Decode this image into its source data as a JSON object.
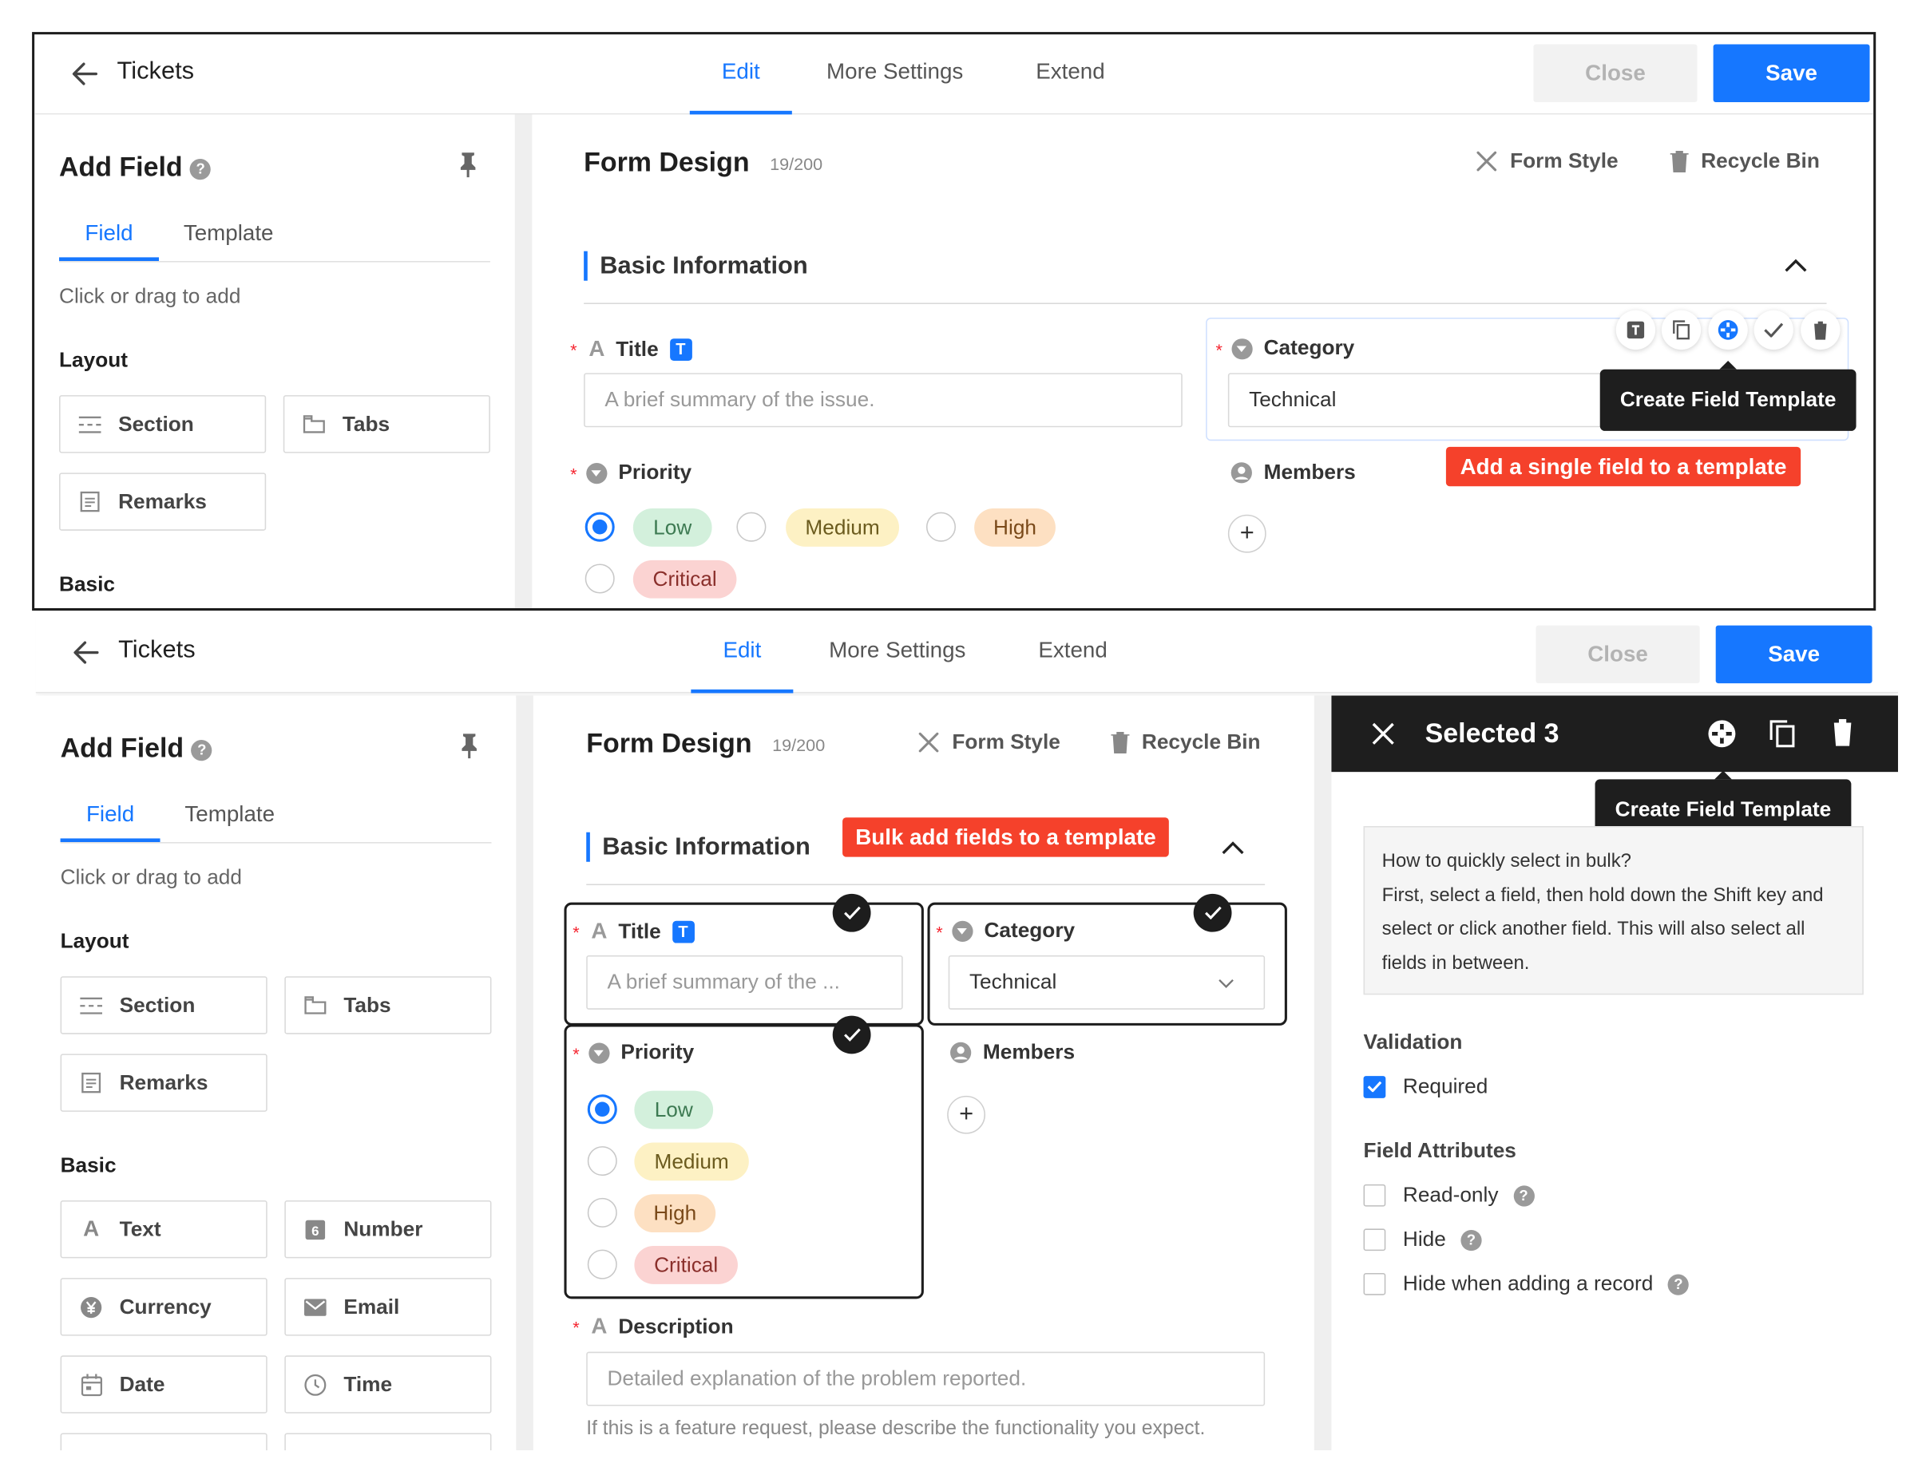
{
  "header": {
    "back_label": "Tickets",
    "tabs": [
      "Edit",
      "More Settings",
      "Extend"
    ],
    "close": "Close",
    "save": "Save"
  },
  "sidebar": {
    "title": "Add Field",
    "tabs": [
      "Field",
      "Template"
    ],
    "hint": "Click or drag to add",
    "layout_label": "Layout",
    "layout_items": [
      "Section",
      "Tabs",
      "Remarks"
    ],
    "basic_label": "Basic",
    "basic_items": [
      "Text",
      "Number",
      "Currency",
      "Email",
      "Date",
      "Time"
    ]
  },
  "form": {
    "title": "Form Design",
    "count": "19/200",
    "form_style": "Form Style",
    "recycle_bin": "Recycle Bin",
    "section": "Basic Information",
    "title_field": {
      "label": "Title",
      "badge": "T",
      "placeholder": "A brief summary of the issue.",
      "placeholder_truncated": "A brief summary of the ..."
    },
    "category_field": {
      "label": "Category",
      "value": "Technical"
    },
    "priority_field": {
      "label": "Priority",
      "options": [
        "Low",
        "Medium",
        "High",
        "Critical"
      ],
      "selected": "Low"
    },
    "members_field": {
      "label": "Members",
      "add": "+"
    },
    "description_field": {
      "label": "Description",
      "placeholder": "Detailed explanation of the problem reported.",
      "help": "If this is a feature request, please describe the functionality you expect."
    }
  },
  "annotations": {
    "single": "Add a single field to a template",
    "bulk": "Bulk add fields to a template",
    "tooltip": "Create Field Template"
  },
  "right_panel": {
    "title": "Selected 3",
    "hint_lines": [
      "How to quickly select in bulk?",
      "First, select a field, then hold down the Shift key and",
      "select or click another field. This will also select all",
      "fields in between."
    ],
    "validation_label": "Validation",
    "required": "Required",
    "required_checked": true,
    "attributes_label": "Field Attributes",
    "attributes": [
      "Read-only",
      "Hide",
      "Hide when adding a record"
    ]
  },
  "colors": {
    "accent": "#1677ff",
    "annotation": "#f5412b",
    "dark": "#1e1e1e"
  }
}
